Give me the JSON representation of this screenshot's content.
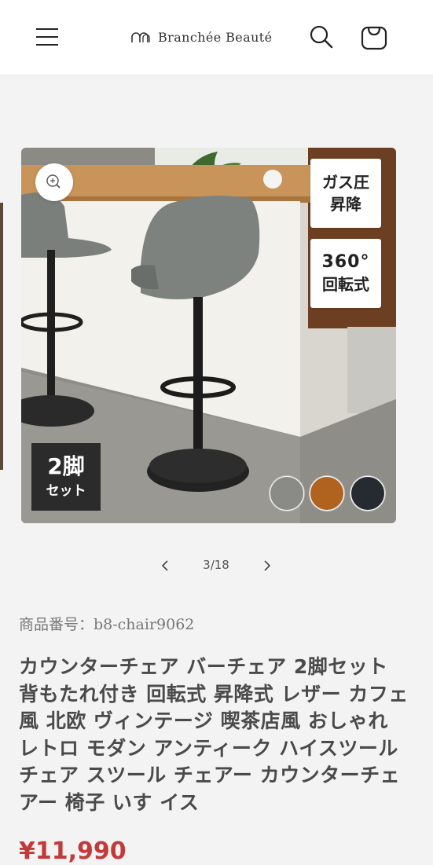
{
  "header": {
    "logo_text": "Branchée Beauté"
  },
  "gallery": {
    "badges": {
      "gas_line1": "ガス圧",
      "gas_line2": "昇降",
      "rotate_line1": "360°",
      "rotate_line2": "回転式",
      "set_line1": "2脚",
      "set_line2": "セット"
    },
    "swatches": [
      {
        "name": "gray",
        "color": "#8a8a86"
      },
      {
        "name": "brown",
        "color": "#b0621f"
      },
      {
        "name": "black",
        "color": "#262a31"
      }
    ],
    "counter": "3/18"
  },
  "product": {
    "sku": "商品番号：b8-chair9062",
    "title": "カウンターチェア バーチェア 2脚セット 背もたれ付き 回転式 昇降式 レザー カフェ風 北欧 ヴィンテージ 喫茶店風 おしゃれ レトロ モダン アンティーク ハイスツール チェア スツール チェアー カウンターチェアー 椅子 いす イス",
    "price": "¥11,990"
  },
  "colors": {
    "header_bg": "#ffffff",
    "page_bg": "#f3f3f3",
    "price": "#c23a3a"
  }
}
